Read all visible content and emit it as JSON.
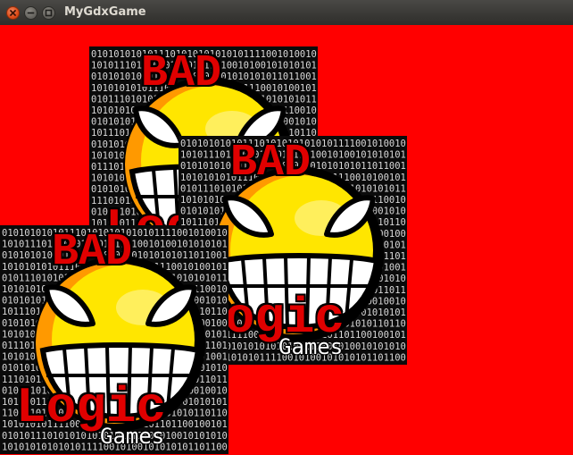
{
  "window": {
    "title": "MyGdxGame",
    "buttons": {
      "close": "close-icon",
      "minimize": "minimize-icon",
      "maximize": "maximize-icon"
    }
  },
  "canvas": {
    "background": "#ff0000"
  },
  "logo": {
    "word_top": "BAD",
    "word_bottom": "Logic",
    "word_sub": "Games",
    "binary_text": "010101010101110101010101010111100101001010101011011001001010101010010011101010101010101010101001010101010101010110101010101001",
    "colors": {
      "red": "#e00000",
      "yellow": "#ffe600",
      "orange": "#ff9900",
      "white": "#ffffff",
      "black": "#0b0b0b"
    }
  }
}
